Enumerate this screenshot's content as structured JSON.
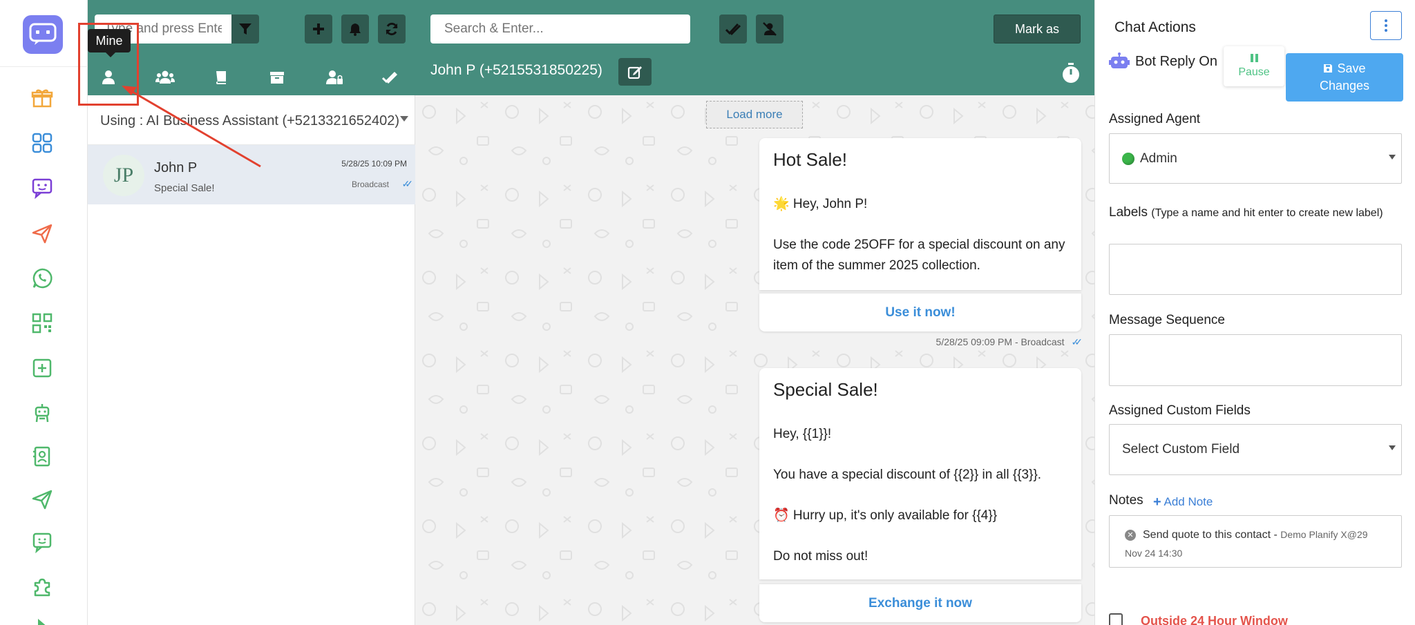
{
  "rail": {
    "icons": [
      "gift-icon",
      "dashboard-grid-icon",
      "chat-bot-icon",
      "paper-plane-icon",
      "whatsapp-icon",
      "qr-code-icon",
      "plus-square-icon",
      "robot-icon",
      "contacts-icon",
      "send-icon",
      "message-smile-icon",
      "puzzle-icon"
    ]
  },
  "list": {
    "search_placeholder": "Type and press Enter",
    "tooltip": "Mine",
    "using": "Using : AI Business Assistant (+5213321652402)",
    "conversation": {
      "initials": "JP",
      "name": "John P",
      "preview": "Special Sale!",
      "date": "5/28/25 10:09 PM",
      "status": "Broadcast"
    }
  },
  "chat": {
    "search_placeholder": "Search & Enter...",
    "mark_as": "Mark as",
    "title": "John P (+5215531850225)",
    "load_more": "Load more",
    "messages": [
      {
        "title": "Hot Sale!",
        "lines": [
          "🌟 Hey, John P!",
          "Use the code 25OFF for a special discount on any item of the summer 2025 collection."
        ],
        "button": "Use it now!",
        "meta": "5/28/25 09:09 PM - Broadcast"
      },
      {
        "title": "Special Sale!",
        "lines": [
          "Hey, {{1}}!",
          "You have a special discount of {{2}} in all {{3}}.",
          "⏰ Hurry up, it's only available for {{4}}",
          "Do not miss out!"
        ],
        "button": "Exchange it now"
      }
    ]
  },
  "actions": {
    "title": "Chat Actions",
    "bot_reply": "Bot Reply On",
    "pause": "Pause",
    "save_line1": "Save",
    "save_line2": "Changes",
    "assigned_agent_label": "Assigned Agent",
    "assigned_agent_value": "Admin",
    "labels_label": "Labels",
    "labels_hint": "(Type a name and hit enter to create new label)",
    "message_sequence_label": "Message Sequence",
    "custom_fields_label": "Assigned Custom Fields",
    "custom_fields_placeholder": "Select Custom Field",
    "notes_label": "Notes",
    "add_note": "Add Note",
    "note_text": "Send quote to this contact -",
    "note_author": "Demo Planify X@29 Nov 24 14:30",
    "outside_window": "Outside 24 Hour Window"
  },
  "colors": {
    "header_green": "#468d7e",
    "dark_green": "#2f5a50",
    "accent_blue": "#3b8ed9",
    "save_blue": "#4ea8f0",
    "annotation_red": "#e2412f"
  }
}
